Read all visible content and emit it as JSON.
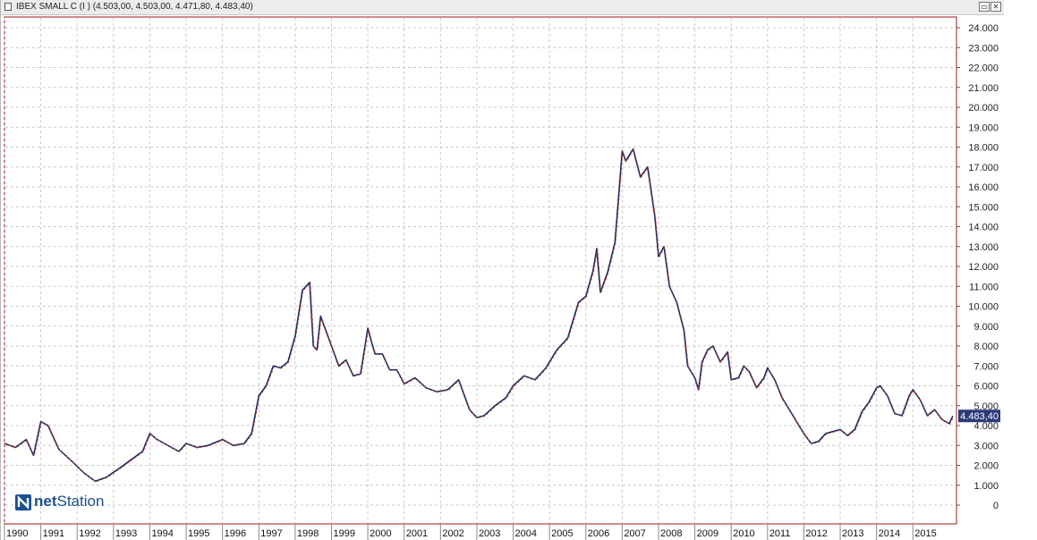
{
  "window": {
    "title": "IBEX SMALL C (I ) (4.503,00, 4.503,00, 4.471,80, 4.483,40)",
    "restore_glyph": "▭",
    "close_glyph": "✕"
  },
  "branding": {
    "logo_net": "net",
    "logo_station": "Station"
  },
  "colors": {
    "up": "#1c2a66",
    "down": "#d8461e",
    "last_badge": "#2a3a7a",
    "frame": "#a01818"
  },
  "chart_data": {
    "type": "line",
    "title": "",
    "xlabel": "",
    "ylabel": "",
    "x_ticks": [
      "1990",
      "1991",
      "1992",
      "1993",
      "1994",
      "1995",
      "1996",
      "1997",
      "1998",
      "1999",
      "2000",
      "2001",
      "2002",
      "2003",
      "2004",
      "2005",
      "2006",
      "2007",
      "2008",
      "2009",
      "2010",
      "2011",
      "2012",
      "2013",
      "2014",
      "2015"
    ],
    "y_ticks": [
      "24.000",
      "23.000",
      "22.000",
      "21.000",
      "20.000",
      "19.000",
      "18.000",
      "17.000",
      "16.000",
      "15.000",
      "14.000",
      "13.000",
      "12.000",
      "11.000",
      "10.000",
      "9.000",
      "8.000",
      "7.000",
      "6.000",
      "5.000",
      "4.000",
      "3.000",
      "2.000",
      "1.000",
      "0"
    ],
    "ylim": [
      0,
      24000
    ],
    "xlim": [
      1990.0,
      2016.2
    ],
    "grid": true,
    "last_value_label": "4.483,40",
    "last_value": 4483.4,
    "series": [
      {
        "x": [
          1990.0,
          1990.3,
          1990.6,
          1990.8,
          1991.0,
          1991.2,
          1991.5,
          1991.8,
          1992.2,
          1992.5,
          1992.8,
          1993.2,
          1993.5,
          1993.8,
          1994.0,
          1994.2,
          1994.5,
          1994.8,
          1995.0,
          1995.3,
          1995.6,
          1996.0,
          1996.3,
          1996.6,
          1996.8,
          1997.0,
          1997.2,
          1997.4,
          1997.6,
          1997.8,
          1998.0,
          1998.2,
          1998.4,
          1998.5,
          1998.6,
          1998.7,
          1998.8,
          1999.0,
          1999.2,
          1999.4,
          1999.6,
          1999.8,
          2000.0,
          2000.1,
          2000.2,
          2000.4,
          2000.6,
          2000.8,
          2001.0,
          2001.3,
          2001.6,
          2001.9,
          2002.2,
          2002.5,
          2002.8,
          2003.0,
          2003.2,
          2003.5,
          2003.8,
          2004.0,
          2004.3,
          2004.6,
          2004.9,
          2005.2,
          2005.5,
          2005.8,
          2006.0,
          2006.2,
          2006.3,
          2006.4,
          2006.6,
          2006.8,
          2007.0,
          2007.1,
          2007.3,
          2007.5,
          2007.7,
          2007.9,
          2008.0,
          2008.15,
          2008.3,
          2008.5,
          2008.7,
          2008.8,
          2009.0,
          2009.1,
          2009.2,
          2009.35,
          2009.5,
          2009.7,
          2009.9,
          2010.0,
          2010.2,
          2010.35,
          2010.5,
          2010.7,
          2010.9,
          2011.0,
          2011.2,
          2011.4,
          2011.6,
          2011.8,
          2012.0,
          2012.2,
          2012.4,
          2012.6,
          2012.8,
          2013.0,
          2013.2,
          2013.4,
          2013.6,
          2013.8,
          2014.0,
          2014.1,
          2014.3,
          2014.5,
          2014.7,
          2014.9,
          2015.0,
          2015.2,
          2015.4,
          2015.6,
          2015.8,
          2016.0,
          2016.1
        ],
        "y": [
          3100,
          2900,
          3300,
          2500,
          4200,
          4000,
          2800,
          2300,
          1600,
          1200,
          1400,
          1900,
          2300,
          2700,
          3600,
          3300,
          3000,
          2700,
          3100,
          2900,
          3000,
          3300,
          3000,
          3100,
          3600,
          5500,
          6000,
          7000,
          6900,
          7200,
          8500,
          10800,
          11200,
          8000,
          7800,
          9500,
          9000,
          8000,
          7000,
          7300,
          6500,
          6600,
          8900,
          8200,
          7600,
          7600,
          6800,
          6800,
          6100,
          6400,
          5900,
          5700,
          5800,
          6300,
          4800,
          4400,
          4500,
          5000,
          5400,
          6000,
          6500,
          6300,
          6900,
          7800,
          8400,
          10200,
          10500,
          11800,
          12900,
          10700,
          11700,
          13200,
          17800,
          17300,
          17900,
          16500,
          17000,
          14500,
          12500,
          13000,
          11000,
          10200,
          8800,
          7000,
          6400,
          5800,
          7200,
          7800,
          8000,
          7200,
          7700,
          6300,
          6400,
          7000,
          6700,
          5900,
          6400,
          6900,
          6300,
          5400,
          4800,
          4200,
          3600,
          3100,
          3200,
          3600,
          3700,
          3800,
          3500,
          3800,
          4700,
          5200,
          5900,
          6000,
          5500,
          4600,
          4500,
          5500,
          5800,
          5300,
          4500,
          4800,
          4300,
          4100,
          4483
        ]
      }
    ]
  }
}
